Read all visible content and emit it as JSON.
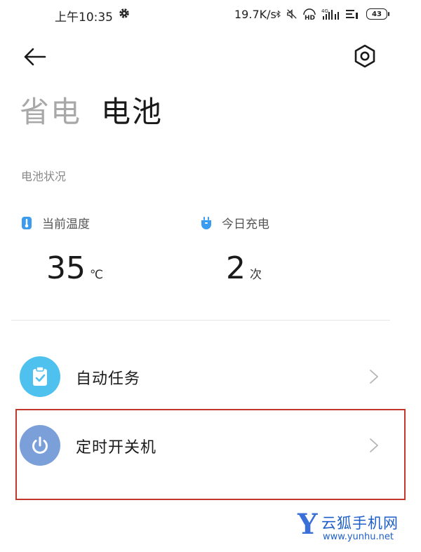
{
  "status_bar": {
    "time": "上午10:35",
    "speed": "19.7K/s",
    "battery_level": "43",
    "icons": [
      "settings-gear-icon",
      "bluetooth-icon",
      "mute-icon",
      "hd-icon",
      "signal-4g-icon",
      "wifi-icon",
      "battery-icon"
    ]
  },
  "header": {
    "back_icon": "arrow-left-icon",
    "settings_icon": "hexagon-settings-icon"
  },
  "tabs": [
    {
      "label": "省电",
      "active": false
    },
    {
      "label": "电池",
      "active": true
    }
  ],
  "battery_status": {
    "section_label": "电池状况",
    "temperature": {
      "label": "当前温度",
      "value": "35",
      "unit": "℃",
      "icon": "thermometer-icon"
    },
    "charges_today": {
      "label": "今日充电",
      "value": "2",
      "unit": "次",
      "icon": "plug-icon"
    }
  },
  "list": [
    {
      "label": "自动任务",
      "icon": "clipboard-check-icon",
      "icon_color": "#4ec1ee"
    },
    {
      "label": "定时开关机",
      "icon": "power-icon",
      "icon_color": "#7b9fd8"
    }
  ],
  "watermark": {
    "letter": "Y",
    "name": "云狐手机网",
    "url": "www.yunhu.net"
  },
  "colors": {
    "accent_blue": "#3a9bef",
    "highlight_border": "#c0392b"
  }
}
